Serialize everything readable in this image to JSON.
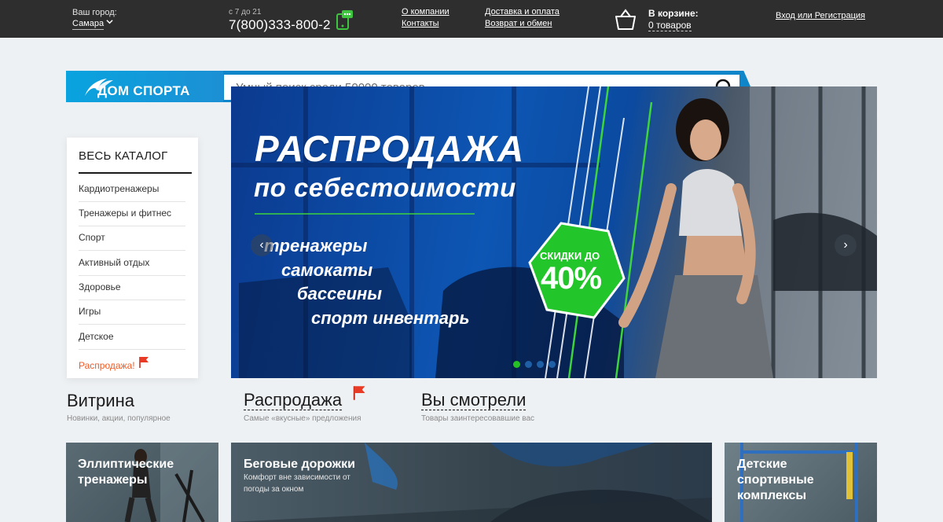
{
  "header": {
    "city_label": "Ваш город:",
    "city_value": "Самара",
    "hours": "с 7 до 21",
    "phone": "7(800)333-800-2",
    "links": [
      "О компании",
      "Контакты",
      "Доставка и оплата",
      "Возврат и обмен"
    ],
    "cart_title": "В корзине:",
    "cart_count": "0 товаров",
    "login": "Вход или Регистрация"
  },
  "logo": {
    "text": "ДОМ СПОРТА"
  },
  "search": {
    "placeholder": "Умный поиск среди 50000 товаров"
  },
  "catalog": {
    "title": "ВЕСЬ КАТАЛОГ",
    "items": [
      "Кардиотренажеры",
      "Тренажеры и фитнес",
      "Спорт",
      "Активный отдых",
      "Здоровье",
      "Игры",
      "Детское"
    ],
    "sale": "Распродажа!"
  },
  "banner": {
    "title": "РАСПРОДАЖА",
    "subtitle": "по себестоимости",
    "lines": [
      "тренажеры",
      "самокаты",
      "бассеины",
      "спорт инвентарь"
    ],
    "badge_top": "СКИДКИ ДО",
    "badge_value": "40%",
    "slides_total": 4,
    "active_slide": 1
  },
  "tabs": [
    {
      "title": "Витрина",
      "subtitle": "Новинки, акции, популярное"
    },
    {
      "title": "Распродажа",
      "subtitle": "Самые «вкусные» предложения"
    },
    {
      "title": "Вы смотрели",
      "subtitle": "Товары заинтересовавшие вас"
    }
  ],
  "tiles": [
    {
      "title": "Эллиптические тренажеры",
      "subtitle": ""
    },
    {
      "title": "Беговые дорожки",
      "subtitle": "Комфорт вне зависимости от погоды за окном"
    },
    {
      "title": "Детские спортивные комплексы",
      "subtitle": ""
    }
  ],
  "colors": {
    "topbar": "#2e2e2e",
    "brand_blue": "#0e86c9",
    "sale_orange": "#f15a24",
    "accent_green": "#24c024",
    "page_bg": "#eef1f4"
  }
}
